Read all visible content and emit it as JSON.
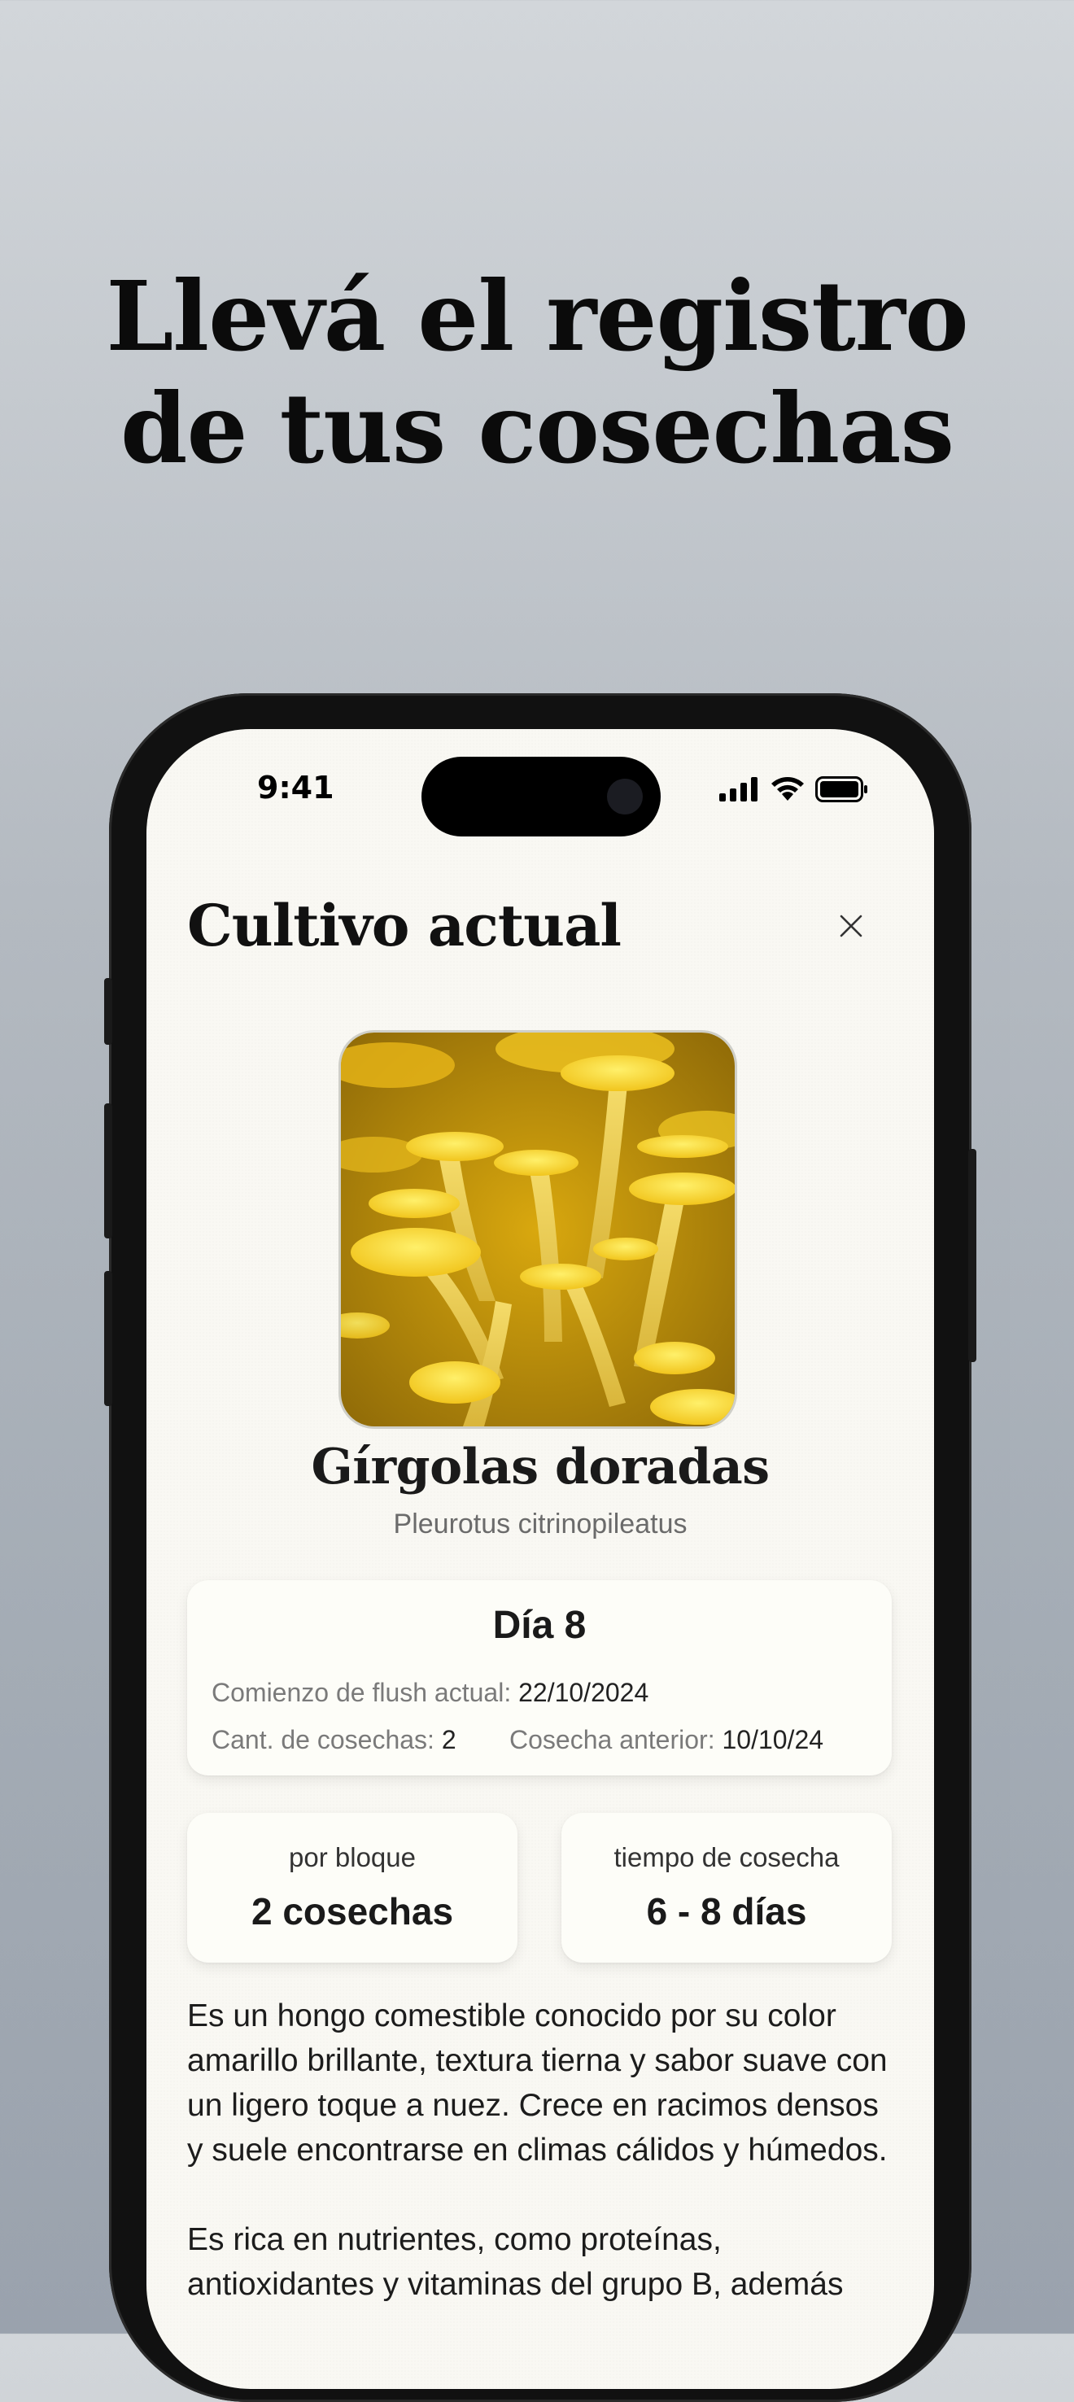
{
  "marketing": {
    "headline_line1": "Llevá el registro",
    "headline_line2": "de tus cosechas"
  },
  "status_bar": {
    "time": "9:41"
  },
  "screen": {
    "title": "Cultivo actual",
    "close_icon": "close-icon",
    "species": {
      "name": "Gírgolas doradas",
      "scientific_name": "Pleurotus citrinopileatus",
      "image": "golden-oyster-mushroom-photo"
    },
    "day_card": {
      "title": "Día 8",
      "flush_start_label": "Comienzo de flush actual:",
      "flush_start_value": "22/10/2024",
      "harvest_count_label": "Cant. de cosechas:",
      "harvest_count_value": "2",
      "previous_harvest_label": "Cosecha anterior:",
      "previous_harvest_value": "10/10/24"
    },
    "stats": [
      {
        "label": "por bloque",
        "value": "2 cosechas"
      },
      {
        "label": "tiempo de cosecha",
        "value": "6 - 8 días"
      }
    ],
    "description": [
      "Es un hongo comestible conocido por su color amarillo brillante, textura tierna y sabor suave con un ligero toque a nuez. Crece en racimos densos y suele encontrarse en climas cálidos y húmedos.",
      "Es rica en nutrientes, como proteínas, antioxidantes y vitaminas del grupo B, además"
    ]
  },
  "colors": {
    "background_top": "#d2d6da",
    "background_bottom": "#9aa2ad",
    "screen_bg": "#f9f8f3",
    "mushroom_yellow": "#f2cf2a"
  }
}
